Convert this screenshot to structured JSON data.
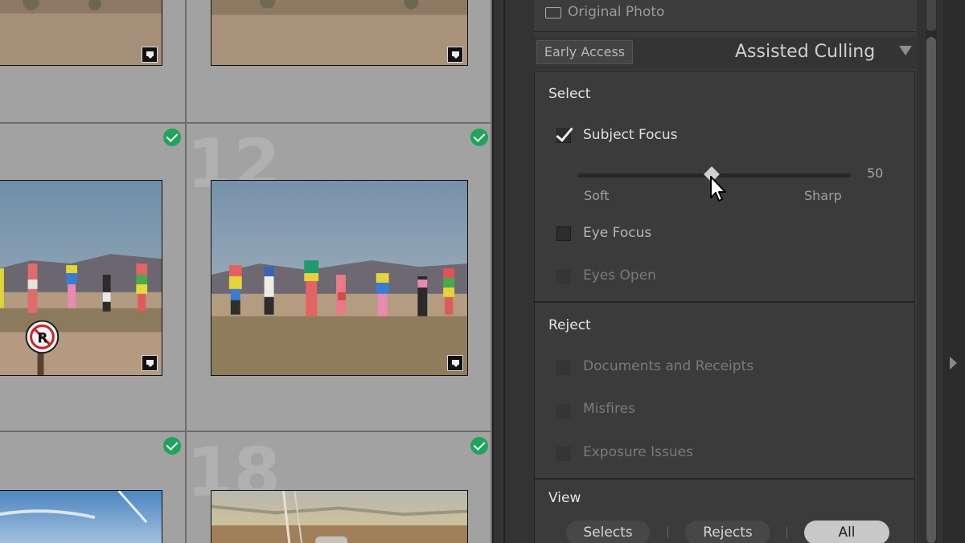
{
  "grid": {
    "cells": [
      {
        "id": "r1c1",
        "number": ""
      },
      {
        "id": "r1c2",
        "number": ""
      },
      {
        "id": "r2c1",
        "number": ""
      },
      {
        "id": "r2c2",
        "number": "12"
      },
      {
        "id": "r3c1",
        "number": ""
      },
      {
        "id": "r3c2",
        "number": "18"
      }
    ],
    "icons": {
      "flag": "check-circle-icon",
      "badge": "comment-badge-icon"
    },
    "colors": {
      "check": "#1fa45a",
      "cell_bg": "#a2a2a2"
    }
  },
  "panel": {
    "original_photo_label": "Original Photo",
    "early_access_label": "Early Access",
    "title": "Assisted Culling",
    "select": {
      "title": "Select",
      "subject_focus": {
        "label": "Subject Focus",
        "checked": true
      },
      "slider": {
        "value": "50",
        "min_label": "Soft",
        "max_label": "Sharp",
        "fraction": 0.5
      },
      "eye_focus": {
        "label": "Eye Focus",
        "checked": false
      },
      "eyes_open": {
        "label": "Eyes Open",
        "checked": false
      }
    },
    "reject": {
      "title": "Reject",
      "items": [
        {
          "label": "Documents and Receipts",
          "checked": false
        },
        {
          "label": "Misfires",
          "checked": false
        },
        {
          "label": "Exposure Issues",
          "checked": false
        }
      ]
    },
    "view": {
      "title": "View",
      "options": [
        "Selects",
        "Rejects",
        "All"
      ],
      "selected": "All"
    }
  }
}
